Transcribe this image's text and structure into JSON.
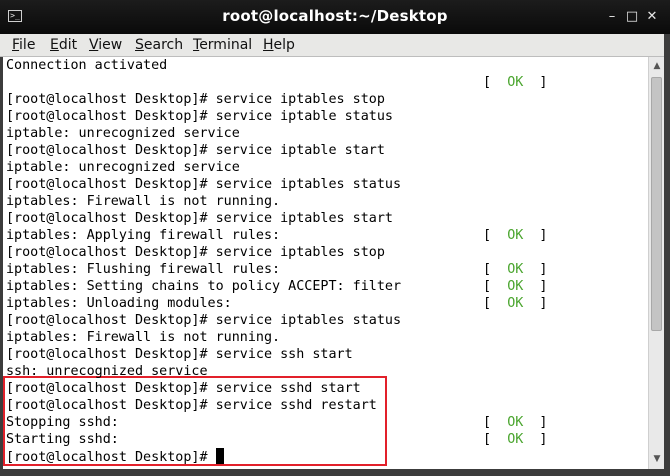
{
  "window": {
    "title": "root@localhost:~/Desktop",
    "icon": "terminal-icon",
    "controls": [
      "close-icon",
      "minimize-icon",
      "maximize-icon"
    ],
    "close_glyph": "✕",
    "minimize_glyph": "–",
    "maximize_glyph": "□"
  },
  "menu": [
    {
      "mnemonic": "F",
      "rest": "ile"
    },
    {
      "mnemonic": "E",
      "rest": "dit"
    },
    {
      "mnemonic": "V",
      "rest": "iew"
    },
    {
      "mnemonic": "S",
      "rest": "earch"
    },
    {
      "mnemonic": "T",
      "rest": "erminal"
    },
    {
      "mnemonic": "H",
      "rest": "elp"
    }
  ],
  "terminal": {
    "lines": [
      {
        "text": "Connection activated",
        "status": ""
      },
      {
        "text": "",
        "status": "OK"
      },
      {
        "text": "[root@localhost Desktop]# service iptables stop",
        "status": ""
      },
      {
        "text": "[root@localhost Desktop]# service iptable status",
        "status": ""
      },
      {
        "text": "iptable: unrecognized service",
        "status": ""
      },
      {
        "text": "[root@localhost Desktop]# service iptable start",
        "status": ""
      },
      {
        "text": "iptable: unrecognized service",
        "status": ""
      },
      {
        "text": "[root@localhost Desktop]# service iptables status",
        "status": ""
      },
      {
        "text": "iptables: Firewall is not running.",
        "status": ""
      },
      {
        "text": "[root@localhost Desktop]# service iptables start",
        "status": ""
      },
      {
        "text": "iptables: Applying firewall rules:",
        "status": "OK"
      },
      {
        "text": "[root@localhost Desktop]# service iptables stop",
        "status": ""
      },
      {
        "text": "iptables: Flushing firewall rules:",
        "status": "OK"
      },
      {
        "text": "iptables: Setting chains to policy ACCEPT: filter",
        "status": "OK"
      },
      {
        "text": "iptables: Unloading modules:",
        "status": "OK"
      },
      {
        "text": "[root@localhost Desktop]# service iptables status",
        "status": ""
      },
      {
        "text": "iptables: Firewall is not running.",
        "status": ""
      },
      {
        "text": "[root@localhost Desktop]# service ssh start",
        "status": ""
      },
      {
        "text": "ssh: unrecognized service",
        "status": ""
      },
      {
        "text": "[root@localhost Desktop]# service sshd start",
        "status": ""
      },
      {
        "text": "[root@localhost Desktop]# service sshd restart",
        "status": ""
      },
      {
        "text": "Stopping sshd:",
        "status": "OK"
      },
      {
        "text": "Starting sshd:",
        "status": "OK"
      },
      {
        "text": "[root@localhost Desktop]# ",
        "status": "",
        "cursor": true
      }
    ],
    "status_open": "[  ",
    "status_close": "  ]"
  },
  "colors": {
    "ok": "#4aa52e",
    "highlight_border": "#e2202a",
    "titlebar": "#111111",
    "terminal_bg": "#ffffff"
  }
}
